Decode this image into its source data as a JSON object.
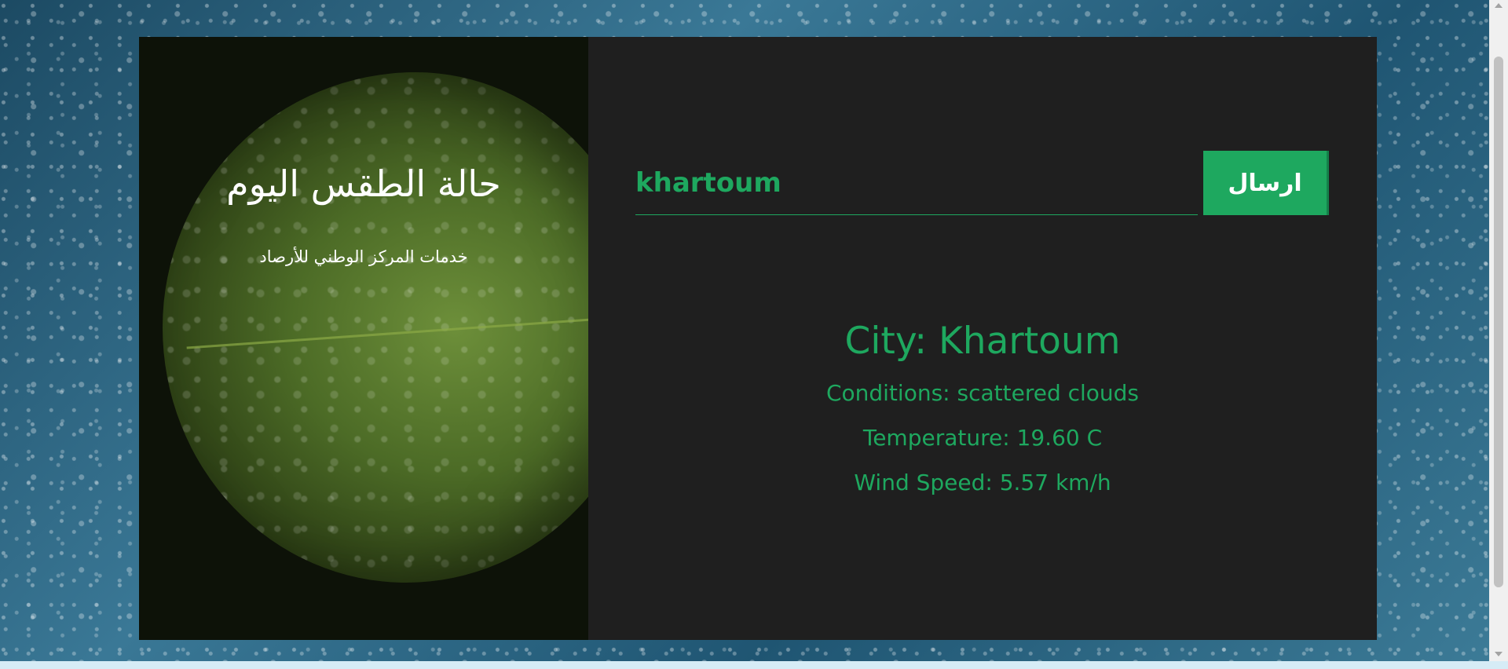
{
  "hero": {
    "title": "حالة الطقس اليوم",
    "subtitle": "خدمات المركز الوطني للأرصاد"
  },
  "search": {
    "value": "khartoum",
    "submit_label": "ارسال"
  },
  "weather": {
    "city": "City: Khartoum",
    "conditions": "Conditions: scattered clouds",
    "temperature": "Temperature: 19.60 C",
    "wind_speed": "Wind Speed: 5.57 km/h"
  },
  "colors": {
    "accent": "#1ea85f",
    "panel": "#1f1f1f",
    "hero_text": "#ffffff"
  }
}
